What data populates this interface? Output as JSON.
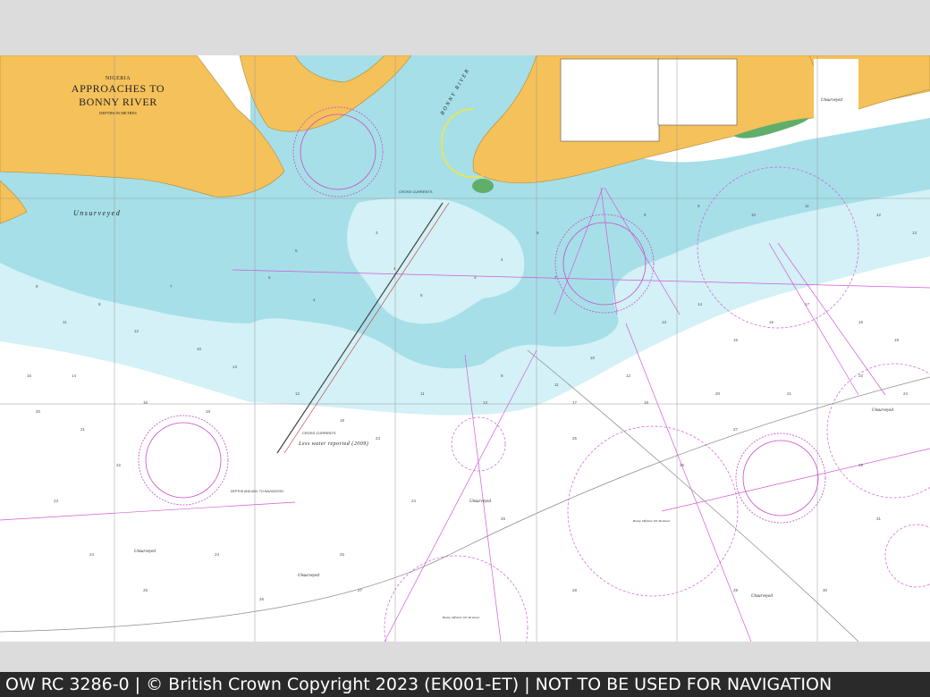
{
  "title_block": {
    "country": "NIGERIA",
    "title_line1": "APPROACHES TO",
    "title_line2": "BONNY RIVER",
    "depths": "DEPTHS IN METRES"
  },
  "labels": {
    "unsurveyed": "Unsurveyed",
    "cross_currents": "CROSS CURRENTS",
    "less_water": "Less water reported (2009)",
    "bonny_river": "BONNY RIVER",
    "depth_and_adv": "DEPTHS AND ADV. TO NAVIGATION",
    "bonny_offshore_oil": "Bonny Offshore Oil Terminal"
  },
  "footer": {
    "text": "OW RC 3286-0 | © British Crown Copyright 2023 (EK001-ET) | NOT TO BE USED FOR NAVIGATION"
  },
  "colors": {
    "land": "#f5c15a",
    "shallow_dark": "#a6dfe8",
    "shallow_light": "#d3f1f6",
    "deep": "#ffffff",
    "magenta": "#d25ad8",
    "footer_bg": "#2a2a2a",
    "viewer_bg": "#dcdcdc"
  }
}
